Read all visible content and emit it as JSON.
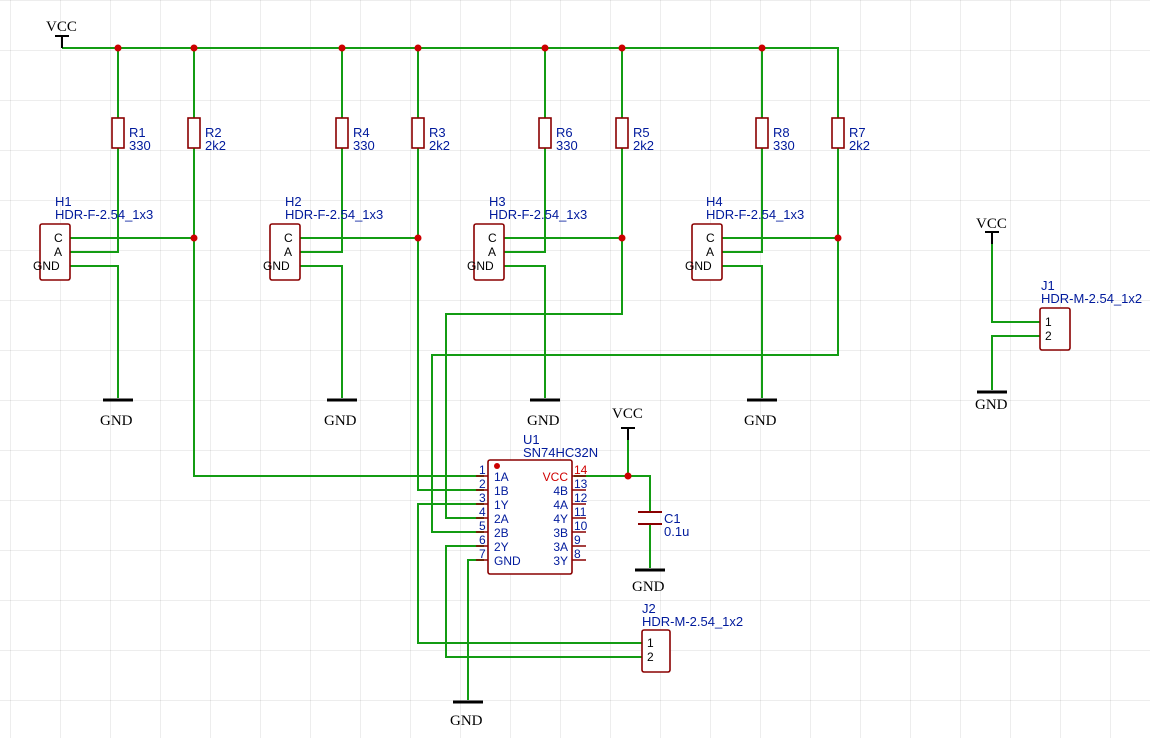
{
  "power": {
    "vcc": "VCC",
    "gnd": "GND"
  },
  "resistors": [
    {
      "ref": "R1",
      "value": "330"
    },
    {
      "ref": "R2",
      "value": "2k2"
    },
    {
      "ref": "R4",
      "value": "330"
    },
    {
      "ref": "R3",
      "value": "2k2"
    },
    {
      "ref": "R6",
      "value": "330"
    },
    {
      "ref": "R5",
      "value": "2k2"
    },
    {
      "ref": "R8",
      "value": "330"
    },
    {
      "ref": "R7",
      "value": "2k2"
    }
  ],
  "sensors": [
    {
      "ref": "H1",
      "value": "HDR-F-2.54_1x3",
      "pins": [
        "C",
        "A",
        "GND"
      ]
    },
    {
      "ref": "H2",
      "value": "HDR-F-2.54_1x3",
      "pins": [
        "C",
        "A",
        "GND"
      ]
    },
    {
      "ref": "H3",
      "value": "HDR-F-2.54_1x3",
      "pins": [
        "C",
        "A",
        "GND"
      ]
    },
    {
      "ref": "H4",
      "value": "HDR-F-2.54_1x3",
      "pins": [
        "C",
        "A",
        "GND"
      ]
    }
  ],
  "ic": {
    "ref": "U1",
    "value": "SN74HC32N",
    "left_pins": [
      {
        "num": "1",
        "name": "1A"
      },
      {
        "num": "2",
        "name": "1B"
      },
      {
        "num": "3",
        "name": "1Y"
      },
      {
        "num": "4",
        "name": "2A"
      },
      {
        "num": "5",
        "name": "2B"
      },
      {
        "num": "6",
        "name": "2Y"
      },
      {
        "num": "7",
        "name": "GND"
      }
    ],
    "right_pins": [
      {
        "num": "14",
        "name": "VCC"
      },
      {
        "num": "13",
        "name": "4B"
      },
      {
        "num": "12",
        "name": "4A"
      },
      {
        "num": "11",
        "name": "4Y"
      },
      {
        "num": "10",
        "name": "3B"
      },
      {
        "num": "9",
        "name": "3A"
      },
      {
        "num": "8",
        "name": "3Y"
      }
    ]
  },
  "capacitor": {
    "ref": "C1",
    "value": "0.1u"
  },
  "connectors": [
    {
      "ref": "J1",
      "value": "HDR-M-2.54_1x2",
      "pins": [
        "1",
        "2"
      ]
    },
    {
      "ref": "J2",
      "value": "HDR-M-2.54_1x2",
      "pins": [
        "1",
        "2"
      ]
    }
  ],
  "colors": {
    "wire": "#139c13",
    "junction": "#cc0000",
    "part": "#8a0000",
    "label": "#001a9c",
    "vcc_pin": "#d00000"
  }
}
